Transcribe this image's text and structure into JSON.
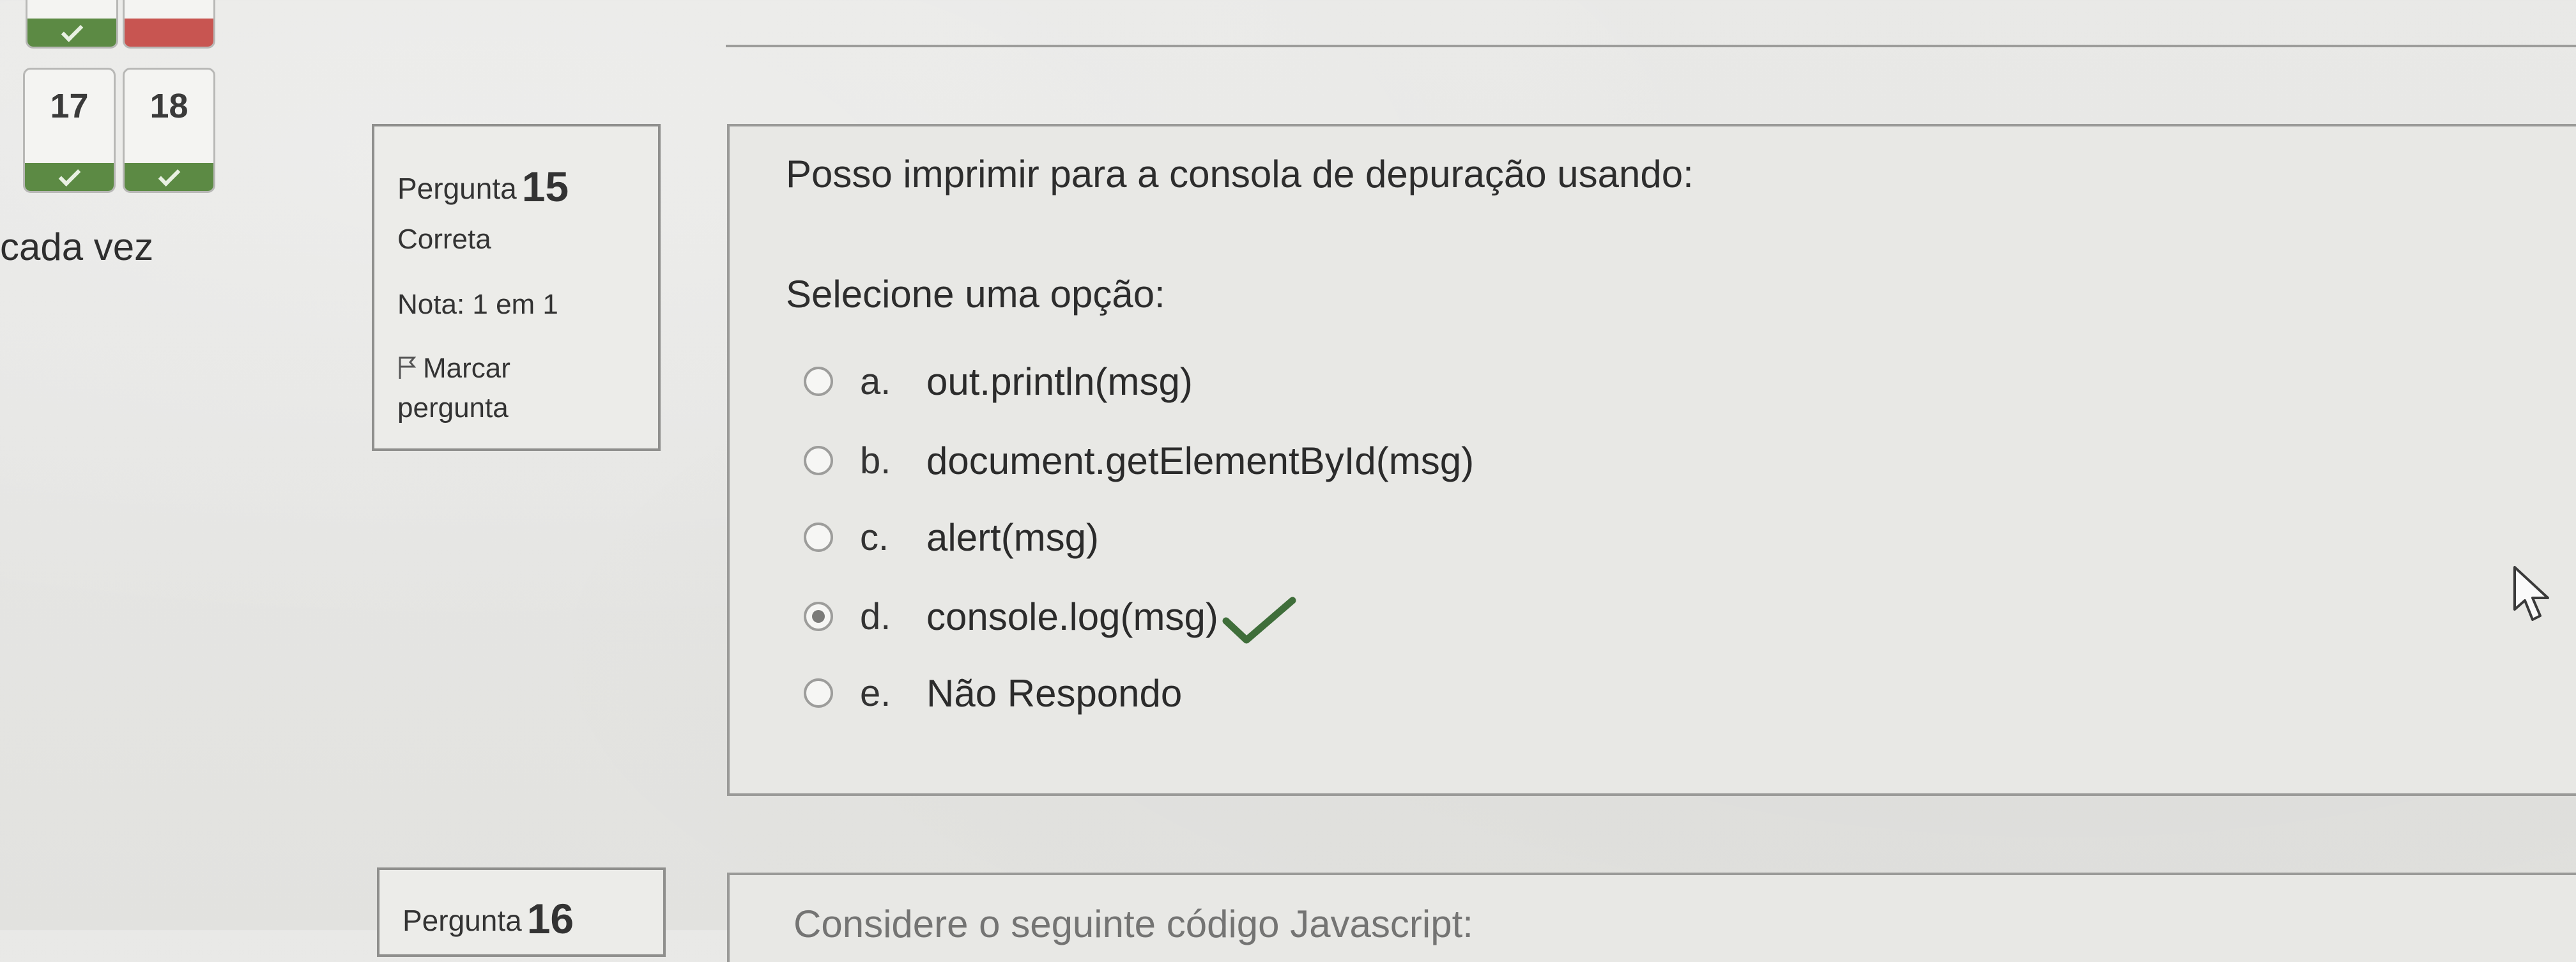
{
  "nav": {
    "buttons": [
      {
        "number": "",
        "state": "correct"
      },
      {
        "number": "",
        "state": "wrong"
      },
      {
        "number": "17",
        "state": "correct"
      },
      {
        "number": "18",
        "state": "correct"
      }
    ]
  },
  "side_text": "cada vez",
  "question_info": {
    "label": "Pergunta",
    "number": "15",
    "status": "Correta",
    "grade": "Nota: 1 em 1",
    "flag_label_line1": "Marcar",
    "flag_label_line2": "pergunta"
  },
  "question": {
    "text": "Posso imprimir para a consola de depuração usando:",
    "select_label": "Selecione uma opção:",
    "options": [
      {
        "letter": "a.",
        "text": "out.println(msg)",
        "selected": false
      },
      {
        "letter": "b.",
        "text": "document.getElementById(msg)",
        "selected": false
      },
      {
        "letter": "c.",
        "text": "alert(msg)",
        "selected": false
      },
      {
        "letter": "d.",
        "text": "console.log(msg)",
        "selected": true,
        "correct_mark": "check-icon"
      },
      {
        "letter": "e.",
        "text": "Não Respondo",
        "selected": false
      }
    ]
  },
  "next_question": {
    "label": "Pergunta",
    "number": "16",
    "text": "Considere o seguinte código Javascript:"
  },
  "colors": {
    "correct": "#5c8a44",
    "wrong": "#c85551",
    "check": "#3f6e3a"
  }
}
